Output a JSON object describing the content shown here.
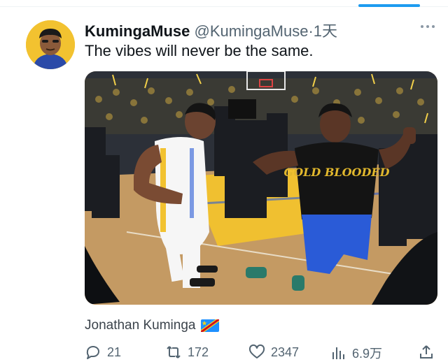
{
  "tweet": {
    "display_name": "KumingaMuse",
    "handle": "@KumingaMuse",
    "separator": "·",
    "time": "1天",
    "text": "The vibes will never be the same.",
    "caption": "Jonathan Kuminga",
    "shirt_text": "GOLD BLOODED"
  },
  "actions": {
    "replies": "21",
    "retweets": "172",
    "likes": "2347",
    "views": "6.9万"
  },
  "icons": {
    "more": "more-dots-icon",
    "reply": "reply-icon",
    "retweet": "retweet-icon",
    "like": "heart-icon",
    "views": "views-chart-icon",
    "share": "share-icon",
    "flag": "congo-flag-icon"
  },
  "colors": {
    "accent": "#1d9bf0",
    "text": "#0f1419",
    "muted": "#536471",
    "warriors_gold": "#f2c230",
    "warriors_blue": "#2a5bd7"
  }
}
